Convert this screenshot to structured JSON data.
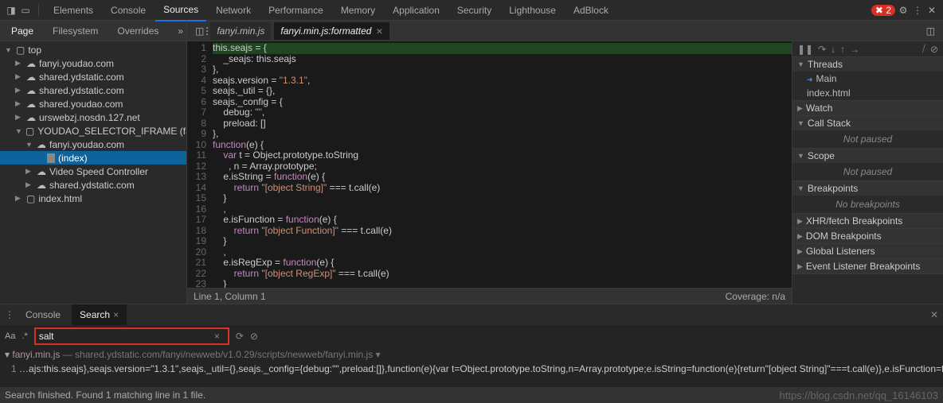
{
  "tabs": {
    "elements": "Elements",
    "console": "Console",
    "sources": "Sources",
    "network": "Network",
    "performance": "Performance",
    "memory": "Memory",
    "application": "Application",
    "security": "Security",
    "lighthouse": "Lighthouse",
    "adblock": "AdBlock",
    "error_count": "2"
  },
  "page_tabs": {
    "page": "Page",
    "filesystem": "Filesystem",
    "overrides": "Overrides"
  },
  "file_tabs": {
    "original": "fanyi.min.js",
    "formatted": "fanyi.min.js:formatted"
  },
  "tree": {
    "top": "top",
    "d0": "fanyi.youdao.com",
    "d1": "shared.ydstatic.com",
    "d2": "shared.ydstatic.com",
    "d3": "shared.youdao.com",
    "d4": "urswebzj.nosdn.127.net",
    "frame": "YOUDAO_SELECTOR_IFRAME (fanyi.youdao.c",
    "fd0": "fanyi.youdao.com",
    "idx": "(index)",
    "fd1": "Video Speed Controller",
    "fd2": "shared.ydstatic.com",
    "ih": "index.html"
  },
  "code": {
    "l1": "this.seajs = {",
    "l2": "    _seajs: this.seajs",
    "l3": "},",
    "l4a": "seajs.version = ",
    "l4b": "\"1.3.1\"",
    "l4c": ",",
    "l5": "seajs._util = {},",
    "l6": "seajs._config = {",
    "l7a": "    debug: ",
    "l7b": "\"\"",
    "l7c": ",",
    "l8": "    preload: []",
    "l9": "},",
    "l10a": "function",
    "l10b": "(e) {",
    "l11a": "    var",
    "l11b": " t = Object.prototype.toString",
    "l12": "      , n = Array.prototype;",
    "l13a": "    e.isString = ",
    "l13b": "function",
    "l13c": "(e) {",
    "l14a": "        return ",
    "l14b": "\"[object String]\"",
    "l14c": " === t.call(e)",
    "l15": "    }",
    "l16": "    ,",
    "l17a": "    e.isFunction = ",
    "l17b": "function",
    "l17c": "(e) {",
    "l18a": "        return ",
    "l18b": "\"[object Function]\"",
    "l18c": " === t.call(e)",
    "l19": "    }",
    "l20": "    ,",
    "l21a": "    e.isRegExp = ",
    "l21b": "function",
    "l21c": "(e) {",
    "l22a": "        return ",
    "l22b": "\"[object RegExp]\"",
    "l22c": " === t.call(e)",
    "l23": "    }"
  },
  "status": {
    "pos": "Line 1, Column 1",
    "cov": "Coverage: n/a"
  },
  "debug": {
    "threads": "Threads",
    "main": "Main",
    "index": "index.html",
    "watch": "Watch",
    "callstack": "Call Stack",
    "np": "Not paused",
    "scope": "Scope",
    "bp": "Breakpoints",
    "nb": "No breakpoints",
    "xhr": "XHR/fetch Breakpoints",
    "dom": "DOM Breakpoints",
    "gl": "Global Listeners",
    "el": "Event Listener Breakpoints"
  },
  "drawer": {
    "console": "Console",
    "search": "Search",
    "aa": "Aa",
    "regex": ".*",
    "input": "salt",
    "file": "fanyi.min.js",
    "path": " — shared.ydstatic.com/fanyi/newweb/v1.0.29/scripts/newweb/fanyi.min.js",
    "ln": "1",
    "snippet": "  …ajs:this.seajs},seajs.version=\"1.3.1\",seajs._util={},seajs._config={debug:\"\",preload:[]},function(e){var t=Object.prototype.toString,n=Array.prototype;e.isString=function(e){return\"[object String]\"===t.call(e)},e.isFunction=function(e){return\"[object Function]\"===t.ca…"
  },
  "footer": {
    "msg": "Search finished.  Found 1 matching line in 1 file.",
    "watermark": "https://blog.csdn.net/qq_16146103"
  }
}
